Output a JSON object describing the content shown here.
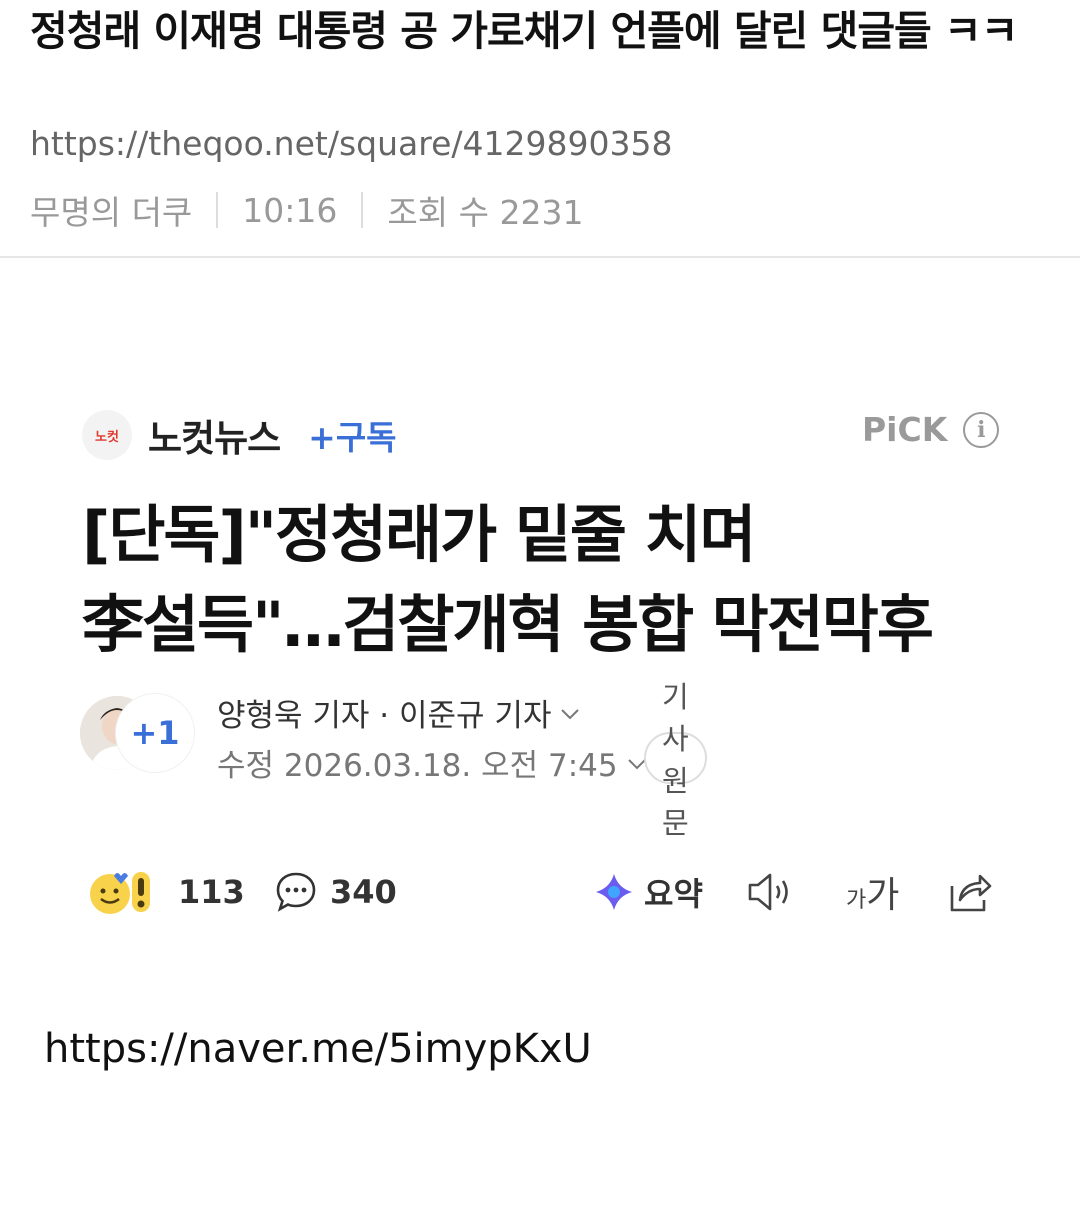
{
  "post": {
    "title": "정청래 이재명 대통령 공 가로채기 언플에 달린 댓글들 ㅋㅋ",
    "url": "https://theqoo.net/square/4129890358",
    "author": "무명의 더쿠",
    "time": "10:16",
    "views": "조회 수 2231"
  },
  "article": {
    "press_logo_text": "노컷",
    "press_name": "노컷뉴스",
    "subscribe_label": "+구독",
    "pick_label": "PiCK",
    "headline": "[단독]\"정청래가 밑줄 치며 李설득\"…검찰개혁 봉합 막전막후",
    "avatar_extra": "+1",
    "authors": "양형욱 기자 · 이준규 기자",
    "modified": "수정 2026.03.18. 오전 7:45",
    "original_label": "기사원문",
    "reactions_count": "113",
    "comments_count": "340",
    "summary_label": "요약",
    "font_label_small": "가",
    "font_label_large": "가"
  },
  "link_url": "https://naver.me/5imypKxU",
  "colors": {
    "accent": "#3a6fd8",
    "press_red": "#e03a2f",
    "meta_gray": "#999999"
  }
}
